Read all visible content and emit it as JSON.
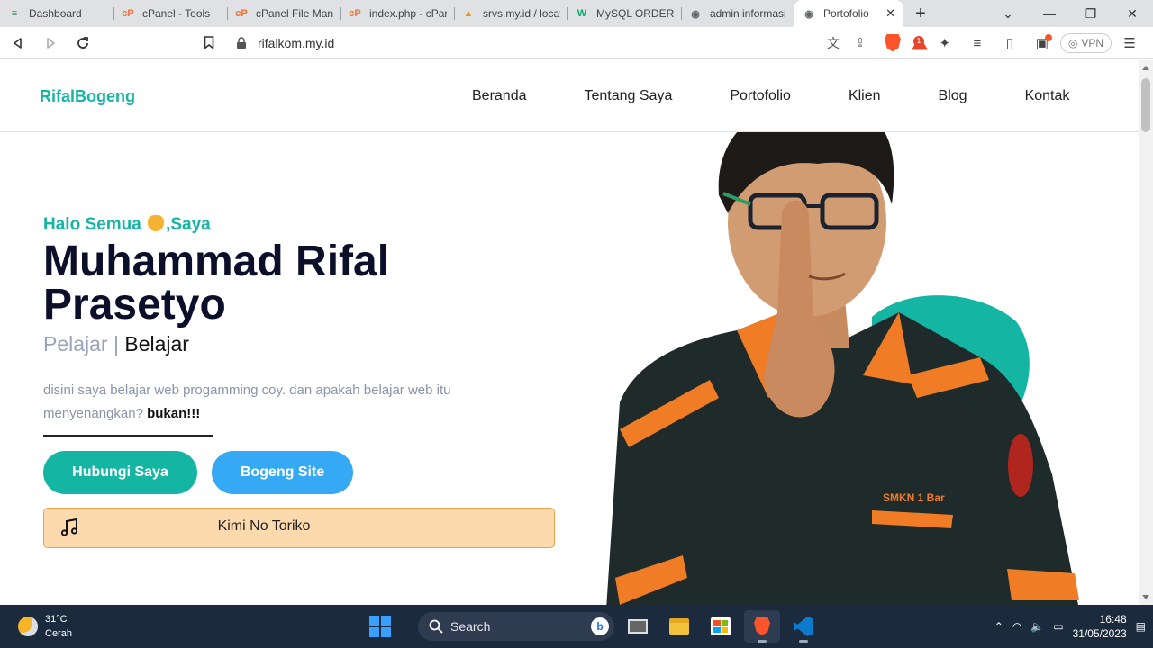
{
  "browser": {
    "tabs": [
      {
        "label": "Dashboard",
        "icon": "database-icon",
        "color": "#2fa36b"
      },
      {
        "label": "cPanel - Tools",
        "icon": "cpanel-icon",
        "color": "#ff6c2c"
      },
      {
        "label": "cPanel File Mana",
        "icon": "cpanel-icon",
        "color": "#ff6c2c"
      },
      {
        "label": "index.php - cPan",
        "icon": "cpanel-icon",
        "color": "#ff6c2c"
      },
      {
        "label": "srvs.my.id / locat",
        "icon": "phpmyadmin-icon",
        "color": "#f29111"
      },
      {
        "label": "MySQL ORDER B",
        "icon": "w3schools-icon",
        "color": "#04aa6d"
      },
      {
        "label": "admin informasi",
        "icon": "globe-icon",
        "color": "#5f6368"
      },
      {
        "label": "Portofolio",
        "icon": "globe-icon",
        "color": "#5f6368",
        "active": true
      }
    ],
    "url": "rifalkom.my.id",
    "vpn_label": "VPN",
    "shield_badge": "1"
  },
  "site": {
    "brand": "RifalBogeng",
    "menu": [
      "Beranda",
      "Tentang Saya",
      "Portofolio",
      "Klien",
      "Blog",
      "Kontak"
    ],
    "greeting_pre": "Halo Semua",
    "greeting_post": ",Saya",
    "name": "Muhammad Rifal Prasetyo",
    "role_muted": "Pelajar |",
    "role_main": "Belajar",
    "description": "disini saya belajar web progamming coy. dan apakah belajar web itu menyenangkan?",
    "description_bold": "bukan!!!",
    "btn_contact": "Hubungi Saya",
    "btn_site": "Bogeng Site",
    "song": "Kimi No Toriko",
    "shirt_text": "SMKN 1 Bar",
    "colors": {
      "accent": "#15b5a4",
      "blue": "#36a9f5",
      "player_bg": "#fddaae"
    }
  },
  "taskbar": {
    "temp": "31°C",
    "condition": "Cerah",
    "search_label": "Search",
    "time": "16:48",
    "date": "31/05/2023"
  }
}
